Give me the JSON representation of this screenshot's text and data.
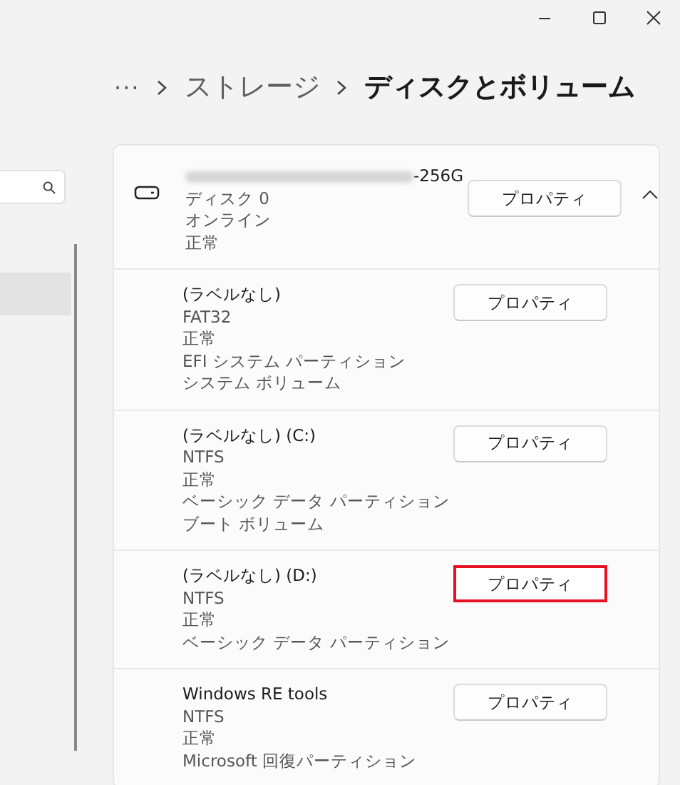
{
  "breadcrumb": {
    "more": "···",
    "items": [
      {
        "label": "ストレージ",
        "current": false
      },
      {
        "label": "ディスクとボリューム",
        "current": true
      }
    ]
  },
  "sidebar": {
    "search": {
      "kind": "search"
    },
    "items": [
      {
        "selected": true
      }
    ]
  },
  "disk": {
    "name_visible": "-256G",
    "name_redacted": true,
    "lines": [
      "ディスク 0",
      "オンライン",
      "正常"
    ],
    "button": "プロパティ",
    "expanded": true
  },
  "volumes": [
    {
      "title": "(ラベルなし)",
      "lines": [
        "FAT32",
        "正常",
        "EFI システム パーティション",
        "システム ボリューム"
      ],
      "button": "プロパティ",
      "highlighted": false
    },
    {
      "title": "(ラベルなし) (C:)",
      "lines": [
        "NTFS",
        "正常",
        "ベーシック データ パーティション",
        "ブート ボリューム"
      ],
      "button": "プロパティ",
      "highlighted": false
    },
    {
      "title": "(ラベルなし) (D:)",
      "lines": [
        "NTFS",
        "正常",
        "ベーシック データ パーティション"
      ],
      "button": "プロパティ",
      "highlighted": true
    },
    {
      "title": "Windows RE tools",
      "lines": [
        "NTFS",
        "正常",
        "Microsoft 回復パーティション"
      ],
      "button": "プロパティ",
      "highlighted": false
    }
  ]
}
